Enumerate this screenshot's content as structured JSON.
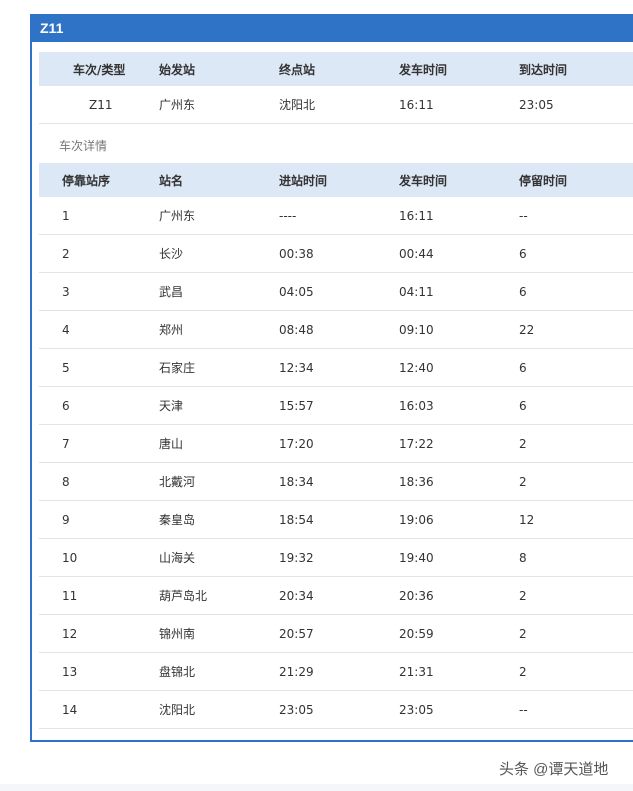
{
  "title": "Z11",
  "summary": {
    "headers": [
      "车次/类型",
      "始发站",
      "终点站",
      "发车时间",
      "到达时间"
    ],
    "values": [
      "Z11",
      "广州东",
      "沈阳北",
      "16:11",
      "23:05"
    ]
  },
  "detail_label": "车次详情",
  "detail": {
    "headers": [
      "停靠站序",
      "站名",
      "进站时间",
      "发车时间",
      "停留时间"
    ],
    "rows": [
      [
        "1",
        "广州东",
        "----",
        "16:11",
        "--"
      ],
      [
        "2",
        "长沙",
        "00:38",
        "00:44",
        "6"
      ],
      [
        "3",
        "武昌",
        "04:05",
        "04:11",
        "6"
      ],
      [
        "4",
        "郑州",
        "08:48",
        "09:10",
        "22"
      ],
      [
        "5",
        "石家庄",
        "12:34",
        "12:40",
        "6"
      ],
      [
        "6",
        "天津",
        "15:57",
        "16:03",
        "6"
      ],
      [
        "7",
        "唐山",
        "17:20",
        "17:22",
        "2"
      ],
      [
        "8",
        "北戴河",
        "18:34",
        "18:36",
        "2"
      ],
      [
        "9",
        "秦皇岛",
        "18:54",
        "19:06",
        "12"
      ],
      [
        "10",
        "山海关",
        "19:32",
        "19:40",
        "8"
      ],
      [
        "11",
        "葫芦岛北",
        "20:34",
        "20:36",
        "2"
      ],
      [
        "12",
        "锦州南",
        "20:57",
        "20:59",
        "2"
      ],
      [
        "13",
        "盘锦北",
        "21:29",
        "21:31",
        "2"
      ],
      [
        "14",
        "沈阳北",
        "23:05",
        "23:05",
        "--"
      ]
    ]
  },
  "watermark": "头条 @谭天道地",
  "colors": {
    "title_bar": "#2f73c6",
    "header_bg": "#dde8f6"
  }
}
